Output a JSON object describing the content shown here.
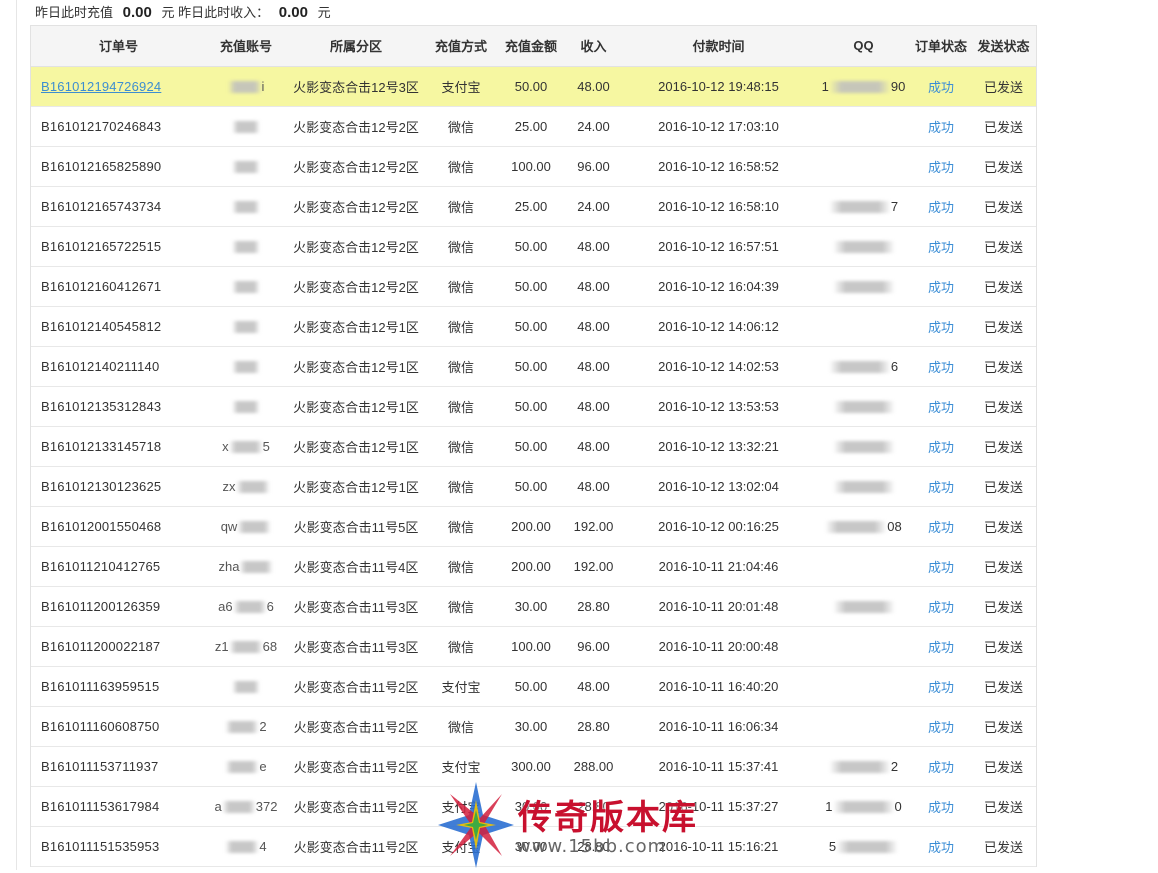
{
  "summary": {
    "recharge_label": "昨日此时充值",
    "recharge_value": "0.00",
    "recharge_unit": "元",
    "income_label": "昨日此时收入：",
    "income_value": "0.00",
    "income_unit": "元"
  },
  "columns": [
    "订单号",
    "充值账号",
    "所属分区",
    "充值方式",
    "充值金额",
    "收入",
    "付款时间",
    "QQ",
    "订单状态",
    "发送状态"
  ],
  "rows": [
    {
      "order": "B161012194726924",
      "acct_pre": "",
      "acct_suf": "i",
      "zone": "火影变态合击12号3区",
      "method": "支付宝",
      "amount": "50.00",
      "income": "48.00",
      "time": "2016-10-12 19:48:15",
      "qq_pre": "1",
      "qq_suf": "90",
      "status": "成功",
      "send": "已发送"
    },
    {
      "order": "B161012170246843",
      "acct_pre": "",
      "acct_suf": "",
      "zone": "火影变态合击12号2区",
      "method": "微信",
      "amount": "25.00",
      "income": "24.00",
      "time": "2016-10-12 17:03:10",
      "qq_pre": "",
      "qq_suf": "",
      "status": "成功",
      "send": "已发送"
    },
    {
      "order": "B161012165825890",
      "acct_pre": "",
      "acct_suf": "",
      "zone": "火影变态合击12号2区",
      "method": "微信",
      "amount": "100.00",
      "income": "96.00",
      "time": "2016-10-12 16:58:52",
      "qq_pre": "",
      "qq_suf": "",
      "status": "成功",
      "send": "已发送"
    },
    {
      "order": "B161012165743734",
      "acct_pre": "",
      "acct_suf": "",
      "zone": "火影变态合击12号2区",
      "method": "微信",
      "amount": "25.00",
      "income": "24.00",
      "time": "2016-10-12 16:58:10",
      "qq_pre": "",
      "qq_suf": "7",
      "status": "成功",
      "send": "已发送"
    },
    {
      "order": "B161012165722515",
      "acct_pre": "",
      "acct_suf": "",
      "zone": "火影变态合击12号2区",
      "method": "微信",
      "amount": "50.00",
      "income": "48.00",
      "time": "2016-10-12 16:57:51",
      "qq_pre": "",
      "qq_suf": "",
      "status": "成功",
      "send": "已发送"
    },
    {
      "order": "B161012160412671",
      "acct_pre": "",
      "acct_suf": "",
      "zone": "火影变态合击12号2区",
      "method": "微信",
      "amount": "50.00",
      "income": "48.00",
      "time": "2016-10-12 16:04:39",
      "qq_pre": "",
      "qq_suf": "",
      "status": "成功",
      "send": "已发送"
    },
    {
      "order": "B161012140545812",
      "acct_pre": "",
      "acct_suf": "",
      "zone": "火影变态合击12号1区",
      "method": "微信",
      "amount": "50.00",
      "income": "48.00",
      "time": "2016-10-12 14:06:12",
      "qq_pre": "",
      "qq_suf": "",
      "status": "成功",
      "send": "已发送"
    },
    {
      "order": "B161012140211140",
      "acct_pre": "",
      "acct_suf": "",
      "zone": "火影变态合击12号1区",
      "method": "微信",
      "amount": "50.00",
      "income": "48.00",
      "time": "2016-10-12 14:02:53",
      "qq_pre": "",
      "qq_suf": "6",
      "status": "成功",
      "send": "已发送"
    },
    {
      "order": "B161012135312843",
      "acct_pre": "",
      "acct_suf": "",
      "zone": "火影变态合击12号1区",
      "method": "微信",
      "amount": "50.00",
      "income": "48.00",
      "time": "2016-10-12 13:53:53",
      "qq_pre": "",
      "qq_suf": "",
      "status": "成功",
      "send": "已发送"
    },
    {
      "order": "B161012133145718",
      "acct_pre": "x",
      "acct_suf": "5",
      "zone": "火影变态合击12号1区",
      "method": "微信",
      "amount": "50.00",
      "income": "48.00",
      "time": "2016-10-12 13:32:21",
      "qq_pre": "",
      "qq_suf": "",
      "status": "成功",
      "send": "已发送"
    },
    {
      "order": "B161012130123625",
      "acct_pre": "zx",
      "acct_suf": "",
      "zone": "火影变态合击12号1区",
      "method": "微信",
      "amount": "50.00",
      "income": "48.00",
      "time": "2016-10-12 13:02:04",
      "qq_pre": "",
      "qq_suf": "",
      "status": "成功",
      "send": "已发送"
    },
    {
      "order": "B161012001550468",
      "acct_pre": "qw",
      "acct_suf": "",
      "zone": "火影变态合击11号5区",
      "method": "微信",
      "amount": "200.00",
      "income": "192.00",
      "time": "2016-10-12 00:16:25",
      "qq_pre": "",
      "qq_suf": "08",
      "status": "成功",
      "send": "已发送"
    },
    {
      "order": "B161011210412765",
      "acct_pre": "zha",
      "acct_suf": "",
      "zone": "火影变态合击11号4区",
      "method": "微信",
      "amount": "200.00",
      "income": "192.00",
      "time": "2016-10-11 21:04:46",
      "qq_pre": "",
      "qq_suf": "",
      "status": "成功",
      "send": "已发送"
    },
    {
      "order": "B161011200126359",
      "acct_pre": "a6",
      "acct_suf": "6",
      "zone": "火影变态合击11号3区",
      "method": "微信",
      "amount": "30.00",
      "income": "28.80",
      "time": "2016-10-11 20:01:48",
      "qq_pre": "",
      "qq_suf": "",
      "status": "成功",
      "send": "已发送"
    },
    {
      "order": "B161011200022187",
      "acct_pre": "z1",
      "acct_suf": "68",
      "zone": "火影变态合击11号3区",
      "method": "微信",
      "amount": "100.00",
      "income": "96.00",
      "time": "2016-10-11 20:00:48",
      "qq_pre": "",
      "qq_suf": "",
      "status": "成功",
      "send": "已发送"
    },
    {
      "order": "B161011163959515",
      "acct_pre": "",
      "acct_suf": "",
      "zone": "火影变态合击11号2区",
      "method": "支付宝",
      "amount": "50.00",
      "income": "48.00",
      "time": "2016-10-11 16:40:20",
      "qq_pre": "",
      "qq_suf": "",
      "status": "成功",
      "send": "已发送"
    },
    {
      "order": "B161011160608750",
      "acct_pre": "",
      "acct_suf": "2",
      "zone": "火影变态合击11号2区",
      "method": "微信",
      "amount": "30.00",
      "income": "28.80",
      "time": "2016-10-11 16:06:34",
      "qq_pre": "",
      "qq_suf": "",
      "status": "成功",
      "send": "已发送"
    },
    {
      "order": "B161011153711937",
      "acct_pre": "",
      "acct_suf": "e",
      "zone": "火影变态合击11号2区",
      "method": "支付宝",
      "amount": "300.00",
      "income": "288.00",
      "time": "2016-10-11 15:37:41",
      "qq_pre": "",
      "qq_suf": "2",
      "status": "成功",
      "send": "已发送"
    },
    {
      "order": "B161011153617984",
      "acct_pre": "a",
      "acct_suf": "372",
      "zone": "火影变态合击11号2区",
      "method": "支付宝",
      "amount": "30.00",
      "income": "28.80",
      "time": "2016-10-11 15:37:27",
      "qq_pre": "1",
      "qq_suf": "0",
      "status": "成功",
      "send": "已发送"
    },
    {
      "order": "B161011151535953",
      "acct_pre": "",
      "acct_suf": "4",
      "zone": "火影变态合击11号2区",
      "method": "支付宝",
      "amount": "30.00",
      "income": "28.80",
      "time": "2016-10-11 15:16:21",
      "qq_pre": "5",
      "qq_suf": "",
      "status": "成功",
      "send": "已发送"
    }
  ],
  "watermark": {
    "title": "传奇版本库",
    "url": "www.15bb.com"
  },
  "colors": {
    "highlight_row": "#f6f7a1",
    "link": "#3d8ed0",
    "status": "#3b8ed6"
  }
}
